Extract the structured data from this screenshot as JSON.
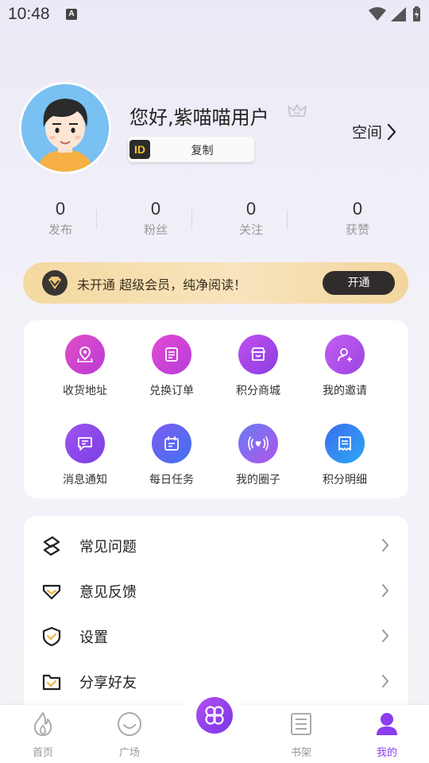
{
  "status_bar": {
    "time": "10:48",
    "notification_badge": "A"
  },
  "profile": {
    "greeting": "您好,紫喵喵用户",
    "id_badge": "ID",
    "copy_label": "复制",
    "space_label": "空间"
  },
  "stats": [
    {
      "value": "0",
      "label": "发布"
    },
    {
      "value": "0",
      "label": "粉丝"
    },
    {
      "value": "0",
      "label": "关注"
    },
    {
      "value": "0",
      "label": "获赞"
    }
  ],
  "vip": {
    "text": "未开通 超级会员，纯净阅读！",
    "button": "开通"
  },
  "grid": [
    {
      "label": "收货地址",
      "icon": "location-icon",
      "color": "#d43fd1"
    },
    {
      "label": "兑换订单",
      "icon": "order-icon",
      "color": "#c93fd8"
    },
    {
      "label": "积分商城",
      "icon": "store-icon",
      "color": "#a94ae6"
    },
    {
      "label": "我的邀请",
      "icon": "invite-icon",
      "color": "#b058e8"
    },
    {
      "label": "消息通知",
      "icon": "message-icon",
      "color": "#8e46e6"
    },
    {
      "label": "每日任务",
      "icon": "calendar-icon",
      "color": "#5a6cf0"
    },
    {
      "label": "我的圈子",
      "icon": "circle-icon",
      "color": "#8a5ef0"
    },
    {
      "label": "积分明细",
      "icon": "receipt-icon",
      "color": "#3e8ff2"
    }
  ],
  "menu": [
    {
      "label": "常见问题",
      "icon": "faq-icon"
    },
    {
      "label": "意见反馈",
      "icon": "feedback-icon"
    },
    {
      "label": "设置",
      "icon": "settings-shield-icon"
    },
    {
      "label": "分享好友",
      "icon": "share-folder-icon"
    }
  ],
  "tabs": [
    {
      "label": "首页",
      "icon": "flame-icon"
    },
    {
      "label": "广场",
      "icon": "smile-icon"
    },
    {
      "label": "书架",
      "icon": "book-icon"
    },
    {
      "label": "我的",
      "icon": "user-icon",
      "active": true
    }
  ],
  "colors": {
    "accent": "#8a3ef0",
    "vip_gold": "#f4d9a0"
  }
}
